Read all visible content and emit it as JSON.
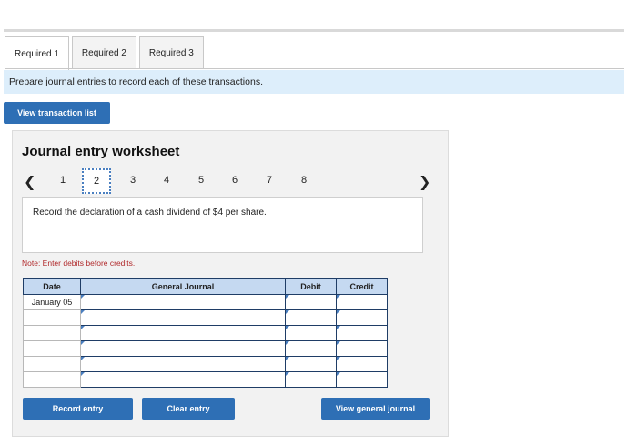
{
  "tabs": [
    {
      "label": "Required 1",
      "active": true
    },
    {
      "label": "Required 2",
      "active": false
    },
    {
      "label": "Required 3",
      "active": false
    }
  ],
  "instruction": "Prepare journal entries to record each of these transactions.",
  "buttons": {
    "view_transaction_list": "View transaction list",
    "record_entry": "Record entry",
    "clear_entry": "Clear entry",
    "view_general_journal": "View general journal"
  },
  "worksheet": {
    "title": "Journal entry worksheet",
    "nav": {
      "prev_icon": "chevron-left-icon",
      "next_icon": "chevron-right-icon",
      "pages": [
        "1",
        "2",
        "3",
        "4",
        "5",
        "6",
        "7",
        "8"
      ],
      "current_page": "2"
    },
    "description": "Record the declaration of a cash dividend of $4 per share.",
    "note": "Note: Enter debits before credits."
  },
  "table": {
    "headers": {
      "date": "Date",
      "general_journal": "General Journal",
      "debit": "Debit",
      "credit": "Credit"
    },
    "rows": [
      {
        "date": "January 05",
        "account": "",
        "debit": "",
        "credit": ""
      },
      {
        "date": "",
        "account": "",
        "debit": "",
        "credit": ""
      },
      {
        "date": "",
        "account": "",
        "debit": "",
        "credit": ""
      },
      {
        "date": "",
        "account": "",
        "debit": "",
        "credit": ""
      },
      {
        "date": "",
        "account": "",
        "debit": "",
        "credit": ""
      },
      {
        "date": "",
        "account": "",
        "debit": "",
        "credit": ""
      }
    ]
  },
  "colors": {
    "button_blue": "#2e6fb5",
    "instruction_bg": "#ddeefb",
    "table_header_bg": "#c5d9f1",
    "note_red": "#b0282a"
  }
}
